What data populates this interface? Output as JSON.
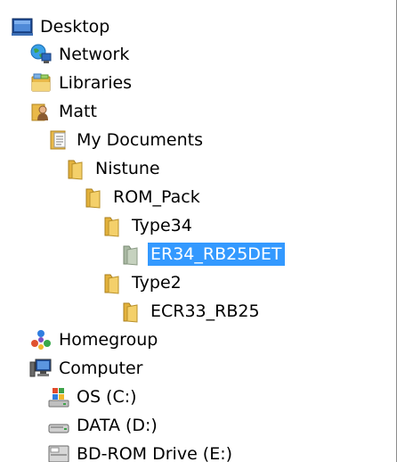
{
  "tree": {
    "items": [
      {
        "id": "desktop",
        "label": "Desktop",
        "icon": "desktop-icon"
      },
      {
        "id": "network",
        "label": "Network",
        "icon": "network-icon"
      },
      {
        "id": "libraries",
        "label": "Libraries",
        "icon": "libraries-icon"
      },
      {
        "id": "matt",
        "label": "Matt",
        "icon": "user-folder-icon"
      },
      {
        "id": "my-documents",
        "label": "My Documents",
        "icon": "documents-icon"
      },
      {
        "id": "nistune",
        "label": "Nistune",
        "icon": "folder-icon"
      },
      {
        "id": "rom-pack",
        "label": "ROM_Pack",
        "icon": "folder-icon"
      },
      {
        "id": "type34",
        "label": "Type34",
        "icon": "folder-icon"
      },
      {
        "id": "er34-rb25det",
        "label": "ER34_RB25DET",
        "icon": "folder-icon",
        "selected": true
      },
      {
        "id": "type2",
        "label": "Type2",
        "icon": "folder-icon"
      },
      {
        "id": "ecr33-rb25",
        "label": "ECR33_RB25",
        "icon": "folder-icon"
      },
      {
        "id": "homegroup",
        "label": "Homegroup",
        "icon": "homegroup-icon"
      },
      {
        "id": "computer",
        "label": "Computer",
        "icon": "computer-icon"
      },
      {
        "id": "os-c",
        "label": "OS (C:)",
        "icon": "windows-drive-icon"
      },
      {
        "id": "data-d",
        "label": "DATA (D:)",
        "icon": "hard-drive-icon"
      },
      {
        "id": "bd-rom-e",
        "label": "BD-ROM Drive (E:)",
        "icon": "optical-drive-icon"
      }
    ]
  },
  "colors": {
    "selection": "#3399ff",
    "folder": "#f0c84a"
  }
}
